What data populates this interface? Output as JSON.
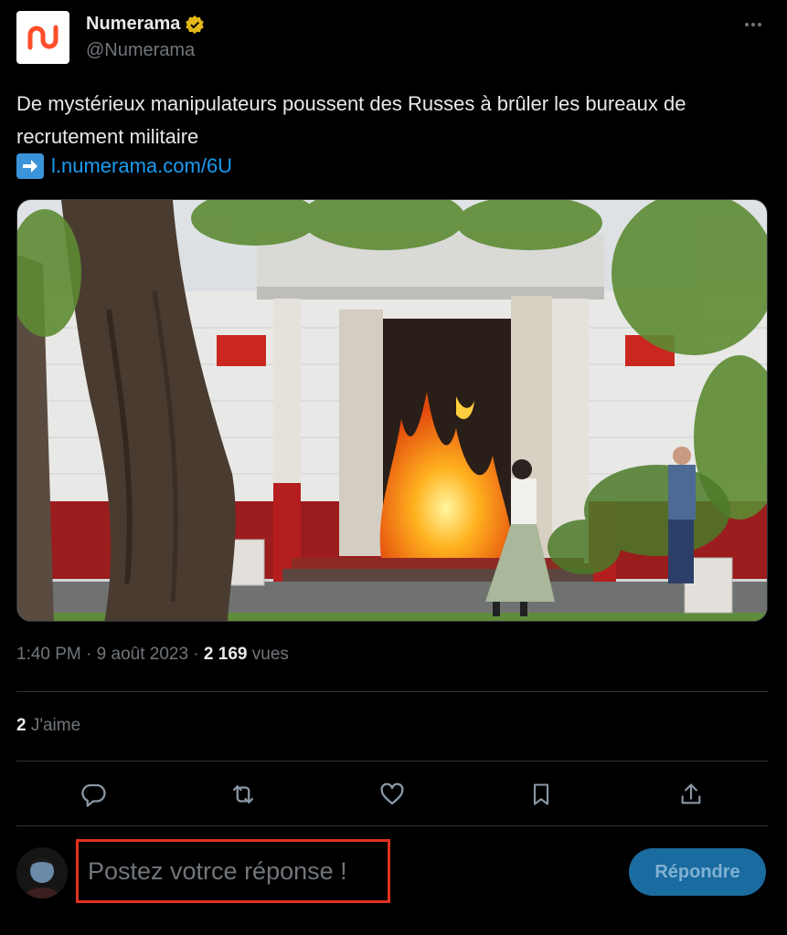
{
  "author": {
    "display_name": "Numerama",
    "handle": "@Numerama",
    "verified": true,
    "logo_color": "#ff4e2a",
    "verified_badge_color": "#e2b719"
  },
  "tweet": {
    "text": "De mystérieux manipulateurs poussent des Russes à brûler les bureaux de recrutement militaire",
    "link_icon": "right-arrow-emoji",
    "link": "l.numerama.com/6U",
    "link_color": "#1d9bf0"
  },
  "media": {
    "description": "photo"
  },
  "meta": {
    "time": "1:40 PM",
    "sep1": "·",
    "date": "9 août 2023",
    "sep2": "·",
    "views_count": "2 169",
    "views_label": "vues"
  },
  "engagement": {
    "likes_count": "2",
    "likes_label": "J'aime"
  },
  "actions": [
    {
      "name": "reply-icon"
    },
    {
      "name": "retweet-icon"
    },
    {
      "name": "like-icon"
    },
    {
      "name": "bookmark-icon"
    },
    {
      "name": "share-icon"
    }
  ],
  "reply": {
    "placeholder": "Postez votrce réponse !",
    "button_label": "Répondre",
    "highlight_color": "#e0321f",
    "button_color": "#1a6b9f"
  }
}
